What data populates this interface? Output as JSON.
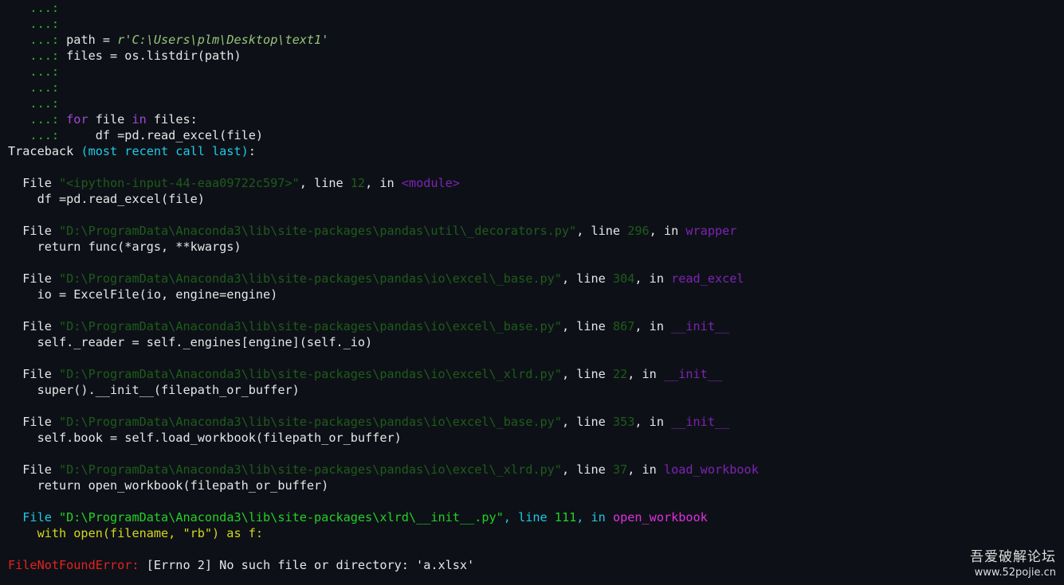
{
  "code_lines": [
    {
      "prompt": "   ...:",
      "code": ""
    },
    {
      "prompt": "   ...:",
      "code": ""
    },
    {
      "prompt": "   ...:",
      "pre": " path = ",
      "str": "r'C:\\Users\\plm\\Desktop\\text1'"
    },
    {
      "prompt": "   ...:",
      "code": " files = os.listdir(path)"
    },
    {
      "prompt": "   ...:",
      "code": ""
    },
    {
      "prompt": "   ...:",
      "code": ""
    },
    {
      "prompt": "   ...:",
      "code": ""
    },
    {
      "prompt": "   ...:",
      "kw1": " for",
      "mid": " file ",
      "kw2": "in",
      "post": " files:"
    },
    {
      "prompt": "   ...:",
      "code": "     df =pd.read_excel(file)"
    }
  ],
  "traceback": {
    "header_word": "Traceback ",
    "header_paren": "(most recent call last)",
    "header_colon": ":",
    "frames": [
      {
        "file": "\"<ipython-input-44-eaa09722c597>\"",
        "line": "12",
        "func": "<module>",
        "src": "    df =pd.read_excel(file)"
      },
      {
        "file": "\"D:\\ProgramData\\Anaconda3\\lib\\site-packages\\pandas\\util\\_decorators.py\"",
        "line": "296",
        "func": "wrapper",
        "src": "    return func(*args, **kwargs)"
      },
      {
        "file": "\"D:\\ProgramData\\Anaconda3\\lib\\site-packages\\pandas\\io\\excel\\_base.py\"",
        "line": "304",
        "func": "read_excel",
        "src": "    io = ExcelFile(io, engine=engine)"
      },
      {
        "file": "\"D:\\ProgramData\\Anaconda3\\lib\\site-packages\\pandas\\io\\excel\\_base.py\"",
        "line": "867",
        "func": "__init__",
        "src": "    self._reader = self._engines[engine](self._io)"
      },
      {
        "file": "\"D:\\ProgramData\\Anaconda3\\lib\\site-packages\\pandas\\io\\excel\\_xlrd.py\"",
        "line": "22",
        "func": "__init__",
        "src": "    super().__init__(filepath_or_buffer)"
      },
      {
        "file": "\"D:\\ProgramData\\Anaconda3\\lib\\site-packages\\pandas\\io\\excel\\_base.py\"",
        "line": "353",
        "func": "__init__",
        "src": "    self.book = self.load_workbook(filepath_or_buffer)"
      },
      {
        "file": "\"D:\\ProgramData\\Anaconda3\\lib\\site-packages\\pandas\\io\\excel\\_xlrd.py\"",
        "line": "37",
        "func": "load_workbook",
        "src": "    return open_workbook(filepath_or_buffer)"
      }
    ],
    "last_frame": {
      "file": "\"D:\\ProgramData\\Anaconda3\\lib\\site-packages\\xlrd\\__init__.py\"",
      "line": "111",
      "func": "open_workbook",
      "src": "    with open(filename, \"rb\") as f:"
    },
    "error_type": "FileNotFoundError:",
    "error_msg": " [Errno 2] No such file or directory: 'a.xlsx'"
  },
  "watermark": {
    "title": "吾爱破解论坛",
    "url": "www.52pojie.cn"
  }
}
